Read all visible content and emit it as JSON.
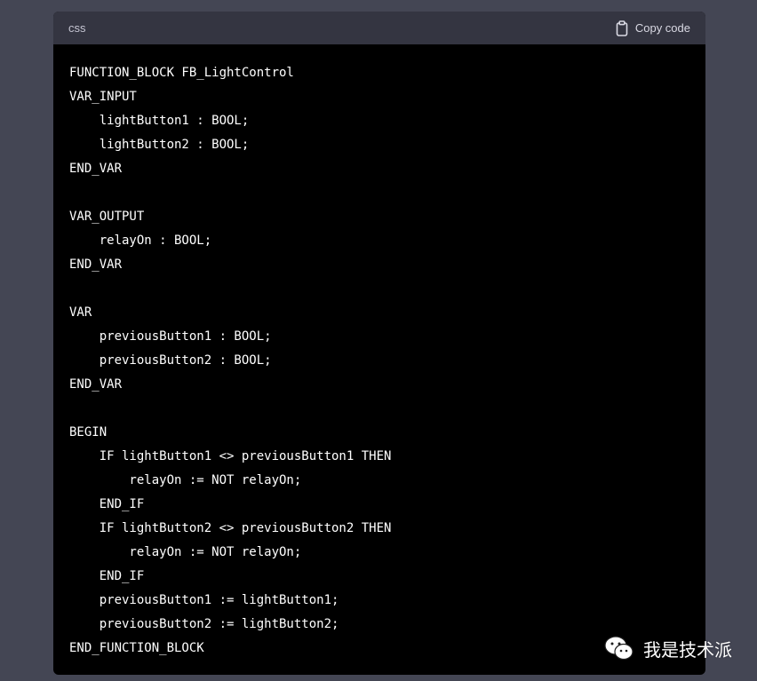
{
  "code_block": {
    "language": "css",
    "copy_label": "Copy code",
    "lines": [
      "FUNCTION_BLOCK FB_LightControl",
      "VAR_INPUT",
      "    lightButton1 : BOOL;",
      "    lightButton2 : BOOL;",
      "END_VAR",
      "",
      "VAR_OUTPUT",
      "    relayOn : BOOL;",
      "END_VAR",
      "",
      "VAR",
      "    previousButton1 : BOOL;",
      "    previousButton2 : BOOL;",
      "END_VAR",
      "",
      "BEGIN",
      "    IF lightButton1 <> previousButton1 THEN",
      "        relayOn := NOT relayOn;",
      "    END_IF",
      "    IF lightButton2 <> previousButton2 THEN",
      "        relayOn := NOT relayOn;",
      "    END_IF",
      "    previousButton1 := lightButton1;",
      "    previousButton2 := lightButton2;",
      "END_FUNCTION_BLOCK"
    ]
  },
  "watermark": {
    "text": "我是技术派",
    "icon": "wechat-icon"
  },
  "colors": {
    "page_background": "#444654",
    "header_background": "#343541",
    "code_background": "#000000",
    "code_text": "#ffffff",
    "header_text": "#d9d9e3"
  }
}
